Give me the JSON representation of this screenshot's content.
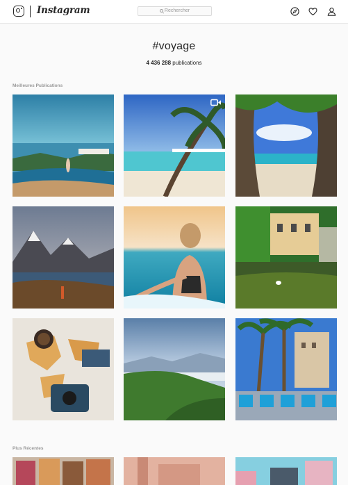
{
  "header": {
    "brand": "Instagram",
    "search_placeholder": "Rechercher",
    "icons": [
      "instagram-logo-icon",
      "explore-compass-icon",
      "activity-heart-icon",
      "profile-icon"
    ]
  },
  "hashtag": {
    "title": "#voyage",
    "post_count": "4 436 288",
    "post_count_unit": "publications"
  },
  "sections": {
    "top_label": "Meilleures Publications",
    "recent_label": "Plus Récentes"
  },
  "top_posts": [
    {
      "subject": "infinity pool by the sea",
      "video": false
    },
    {
      "subject": "palm tree over turquoise beach",
      "video": true
    },
    {
      "subject": "beach framed by palm trunks",
      "video": false
    },
    {
      "subject": "mountain lake at dusk",
      "video": false
    },
    {
      "subject": "woman in the sea at sunset",
      "video": false
    },
    {
      "subject": "villa and pond with swan",
      "video": false
    },
    {
      "subject": "travel map with camera",
      "video": false
    },
    {
      "subject": "green hills above sea of clouds",
      "video": false
    },
    {
      "subject": "palm trees and blue chairs",
      "video": false
    }
  ]
}
